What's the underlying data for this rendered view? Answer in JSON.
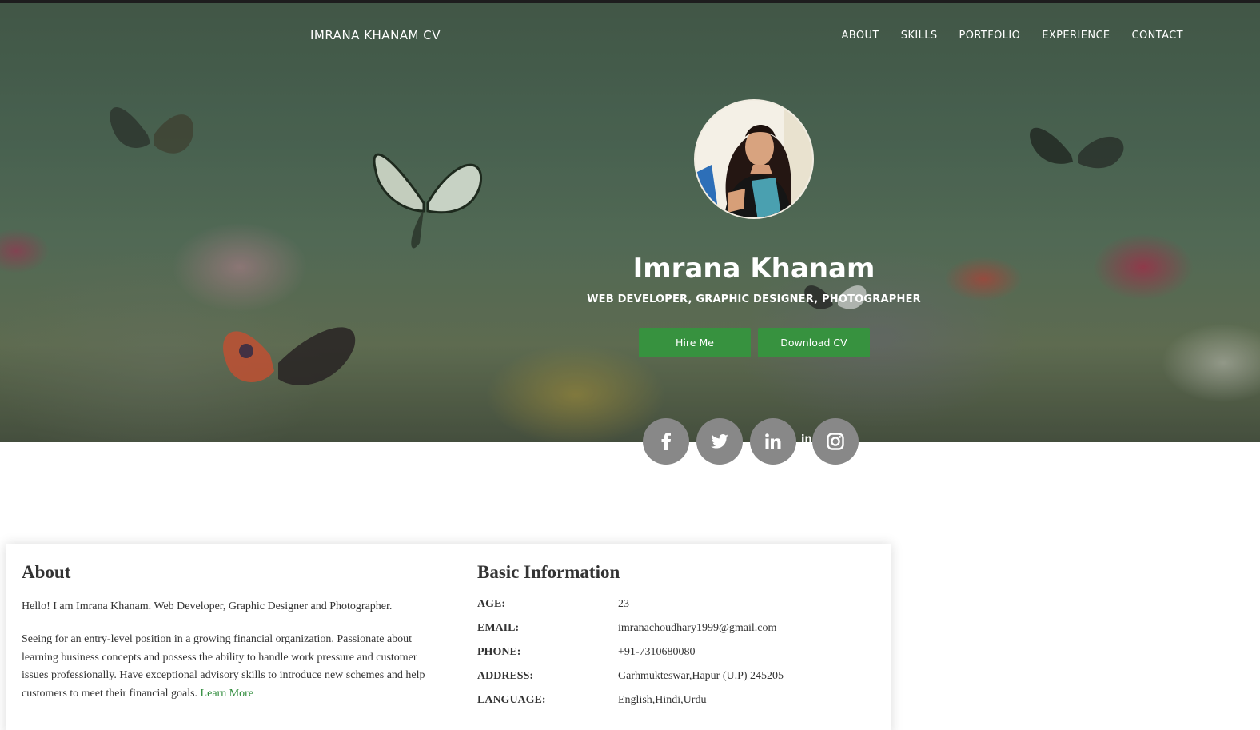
{
  "nav": {
    "brand": "IMRANA KHANAM CV",
    "items": [
      "ABOUT",
      "SKILLS",
      "PORTFOLIO",
      "EXPERIENCE",
      "CONTACT"
    ]
  },
  "hero": {
    "name": "Imrana Khanam",
    "roles": "WEB DEVELOPER, GRAPHIC DESIGNER, PHOTOGRAPHER",
    "hire_label": "Hire Me",
    "download_label": "Download CV",
    "social_icons": [
      "facebook-icon",
      "twitter-icon",
      "linkedin-icon",
      "instagram-icon"
    ],
    "stray_text": "in"
  },
  "about": {
    "heading": "About",
    "intro": "Hello! I am Imrana Khanam. Web Developer, Graphic Designer and Photographer.",
    "body": "Seeing for an entry-level position in a growing financial organization. Passionate about learning business concepts and possess the ability to handle work pressure and customer issues professionally. Have exceptional advisory skills to introduce new schemes and help customers to meet their financial goals.",
    "learn_more": "Learn More"
  },
  "basic_info": {
    "heading": "Basic Information",
    "rows": [
      {
        "label": "AGE:",
        "value": "23"
      },
      {
        "label": "EMAIL:",
        "value": "imranachoudhary1999@gmail.com"
      },
      {
        "label": "PHONE:",
        "value": "+91-7310680080"
      },
      {
        "label": "ADDRESS:",
        "value": "Garhmukteswar,Hapur (U.P) 245205"
      },
      {
        "label": "LANGUAGE:",
        "value": "English,Hindi,Urdu"
      }
    ]
  },
  "colors": {
    "accent_green": "#37923f",
    "link_green": "#2e8b3a",
    "social_grey": "#888888"
  }
}
